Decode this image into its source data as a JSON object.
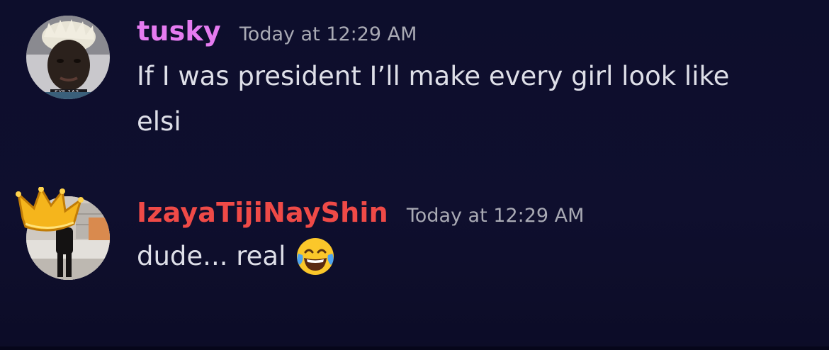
{
  "messages": [
    {
      "username": "tusky",
      "timestamp": "Today at 12:29 AM",
      "lines": [
        "If I was president I’ll make every girl look like",
        "elsi"
      ],
      "username_color": "#e57bf0",
      "avatar": "user-avatar-tusky"
    },
    {
      "username": "IzayaTijiNayShin",
      "timestamp": "Today at 12:29 AM",
      "text": "dude... real",
      "emoji": "face-with-tears-of-joy-icon",
      "username_color": "#ef4a47",
      "avatar": "user-avatar-izaya",
      "avatar_decoration": "crown-icon"
    }
  ],
  "theme": {
    "background": "#0e0e2a",
    "text": "#dedfe8",
    "timestamp": "#a9aab4"
  }
}
